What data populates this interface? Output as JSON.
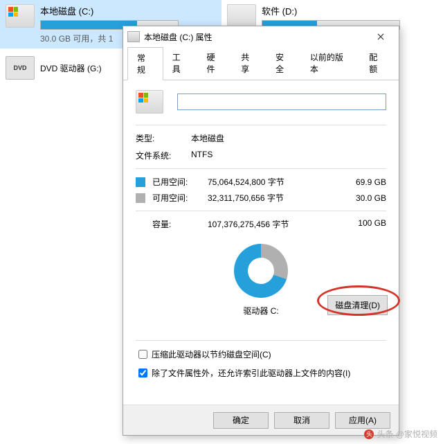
{
  "explorer": {
    "drives": [
      {
        "name": "本地磁盘 (C:)",
        "sub": "30.0 GB 可用，共 1",
        "fill_pct": 70,
        "selected": true
      },
      {
        "name": "软件 (D:)",
        "sub": "",
        "fill_pct": 40,
        "selected": false
      }
    ],
    "dvd": "DVD 驱动器 (G:)",
    "dvd_badge": "DVD"
  },
  "dialog": {
    "title": "本地磁盘 (C:) 属性",
    "tabs": [
      "常规",
      "工具",
      "硬件",
      "共享",
      "安全",
      "以前的版本",
      "配额"
    ],
    "active_tab": 0,
    "name_value": "",
    "type_label": "类型:",
    "type_value": "本地磁盘",
    "fs_label": "文件系统:",
    "fs_value": "NTFS",
    "used_label": "已用空间:",
    "used_bytes": "75,064,524,800 字节",
    "used_gb": "69.9 GB",
    "free_label": "可用空间:",
    "free_bytes": "32,311,750,656 字节",
    "free_gb": "30.0 GB",
    "cap_label": "容量:",
    "cap_bytes": "107,376,275,456 字节",
    "cap_gb": "100 GB",
    "drive_label": "驱动器 C:",
    "cleanup_btn": "磁盘清理(D)",
    "compress_label": "压缩此驱动器以节约磁盘空间(C)",
    "index_label": "除了文件属性外，还允许索引此驱动器上文件的内容(I)",
    "compress_checked": false,
    "index_checked": true,
    "ok": "确定",
    "cancel": "取消",
    "apply": "应用(A)"
  },
  "watermark": "头条 @家悦视频",
  "chart_data": {
    "type": "pie",
    "title": "驱动器 C:",
    "series": [
      {
        "name": "已用空间",
        "value": 69.9,
        "color": "#26a0da"
      },
      {
        "name": "可用空间",
        "value": 30.0,
        "color": "#b0b0b0"
      }
    ],
    "unit": "GB",
    "total": 100
  }
}
